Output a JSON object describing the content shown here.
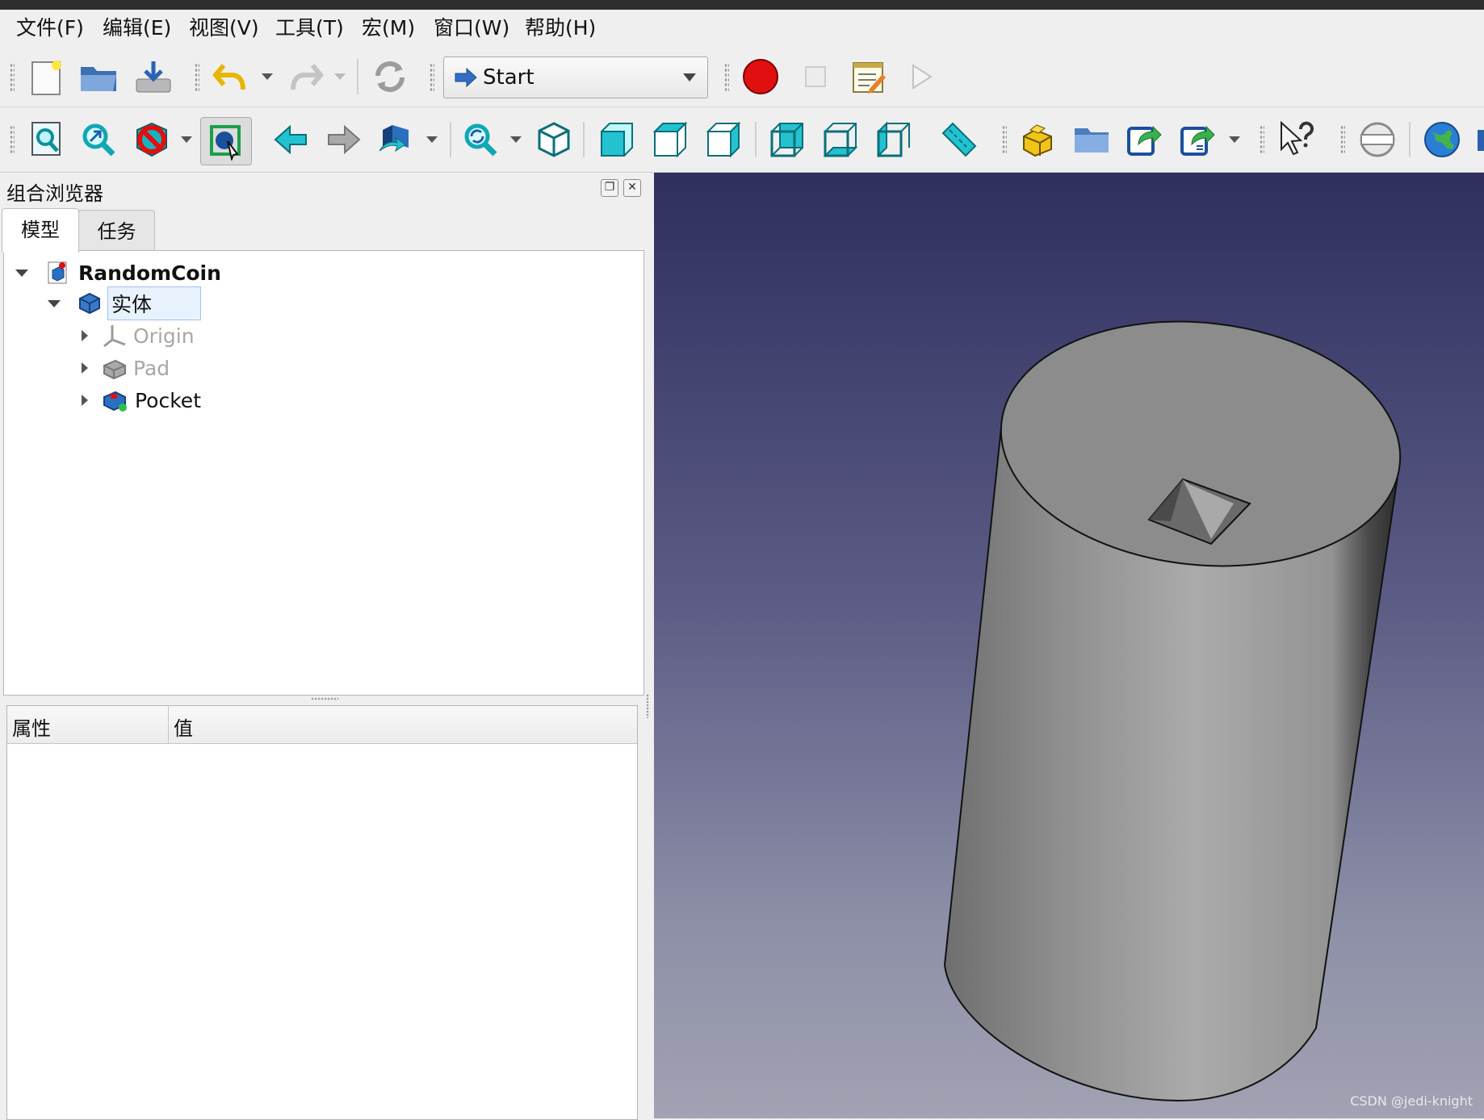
{
  "menu": [
    {
      "label": "文件(F)"
    },
    {
      "label": "编辑(E)"
    },
    {
      "label": "视图(V)"
    },
    {
      "label": "工具(T)"
    },
    {
      "label": "宏(M)"
    },
    {
      "label": "窗口(W)"
    },
    {
      "label": "帮助(H)"
    }
  ],
  "workbench": {
    "selected": "Start"
  },
  "panel": {
    "title": "组合浏览器"
  },
  "tabs": [
    {
      "label": "模型"
    },
    {
      "label": "任务"
    }
  ],
  "tree": {
    "root": "RandomCoin",
    "body": "实体",
    "children": [
      "Origin",
      "Pad",
      "Pocket"
    ]
  },
  "properties": {
    "col_property": "属性",
    "col_value": "值"
  },
  "watermark": "CSDN @jedi-knight",
  "colors": {
    "viewport_top": "#2f2f60",
    "viewport_bottom": "#a1a2b2",
    "accent_cyan": "#19c3d0",
    "record_red": "#e01010"
  }
}
